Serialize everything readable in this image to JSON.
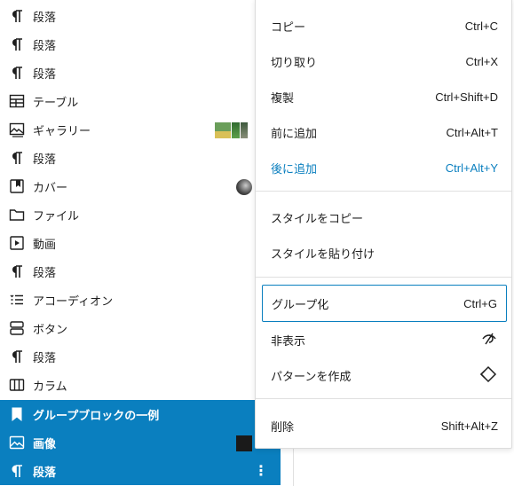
{
  "list_view": {
    "items": [
      {
        "label": "段落",
        "icon": "paragraph-icon"
      },
      {
        "label": "段落",
        "icon": "paragraph-icon"
      },
      {
        "label": "段落",
        "icon": "paragraph-icon"
      },
      {
        "label": "テーブル",
        "icon": "table-icon"
      },
      {
        "label": "ギャラリー",
        "icon": "gallery-icon"
      },
      {
        "label": "段落",
        "icon": "paragraph-icon"
      },
      {
        "label": "カバー",
        "icon": "cover-icon"
      },
      {
        "label": "ファイル",
        "icon": "file-icon"
      },
      {
        "label": "動画",
        "icon": "video-icon"
      },
      {
        "label": "段落",
        "icon": "paragraph-icon"
      },
      {
        "label": "アコーディオン",
        "icon": "accordion-icon"
      },
      {
        "label": "ボタン",
        "icon": "buttons-icon"
      },
      {
        "label": "段落",
        "icon": "paragraph-icon"
      },
      {
        "label": "カラム",
        "icon": "columns-icon"
      },
      {
        "label": "グループブロックの一例",
        "icon": "bookmark-icon"
      },
      {
        "label": "画像",
        "icon": "image-icon"
      },
      {
        "label": "段落",
        "icon": "paragraph-icon"
      }
    ],
    "selection_color": "#0a7fbf"
  },
  "context_menu": {
    "group1": [
      {
        "label": "コピー",
        "shortcut": "Ctrl+C"
      },
      {
        "label": "切り取り",
        "shortcut": "Ctrl+X"
      },
      {
        "label": "複製",
        "shortcut": "Ctrl+Shift+D"
      },
      {
        "label": "前に追加",
        "shortcut": "Ctrl+Alt+T"
      },
      {
        "label": "後に追加",
        "shortcut": "Ctrl+Alt+Y"
      }
    ],
    "group2": [
      {
        "label": "スタイルをコピー"
      },
      {
        "label": "スタイルを貼り付け"
      }
    ],
    "group3": [
      {
        "label": "グループ化",
        "shortcut": "Ctrl+G"
      },
      {
        "label": "非表示",
        "icon": "hidden-eye-icon"
      },
      {
        "label": "パターンを作成",
        "icon": "pattern-diamond-icon"
      }
    ],
    "group4": [
      {
        "label": "削除",
        "shortcut": "Shift+Alt+Z"
      }
    ],
    "accent_color": "#0a7fbf"
  }
}
